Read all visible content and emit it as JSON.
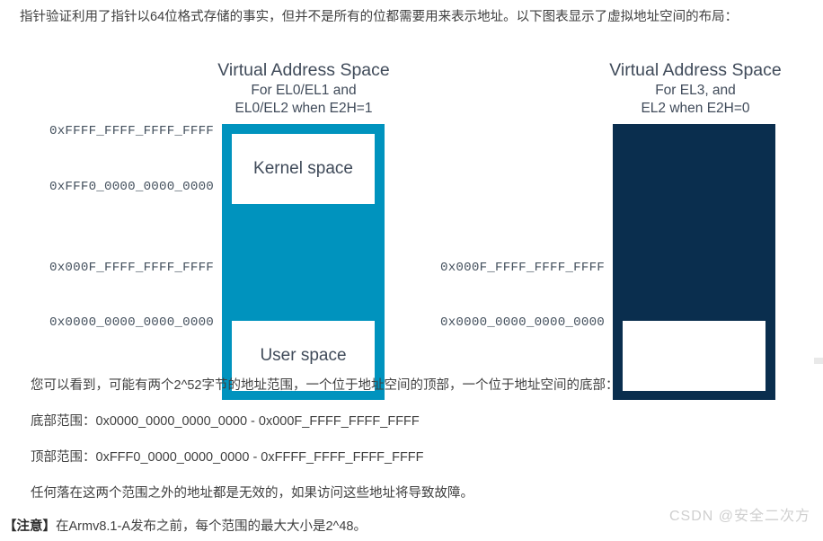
{
  "intro": {
    "text": "指针验证利用了指针以64位格式存储的事实，但并不是所有的位都需要用来表示地址。以下图表显示了虚拟地址空间的布局："
  },
  "figure": {
    "diagrams": [
      {
        "id": "left",
        "title_main": "Virtual Address Space",
        "title_sub_line1": "For EL0/EL1 and",
        "title_sub_line2": "EL0/EL2 when E2H=1",
        "fill_color": "#0093BE",
        "regions": [
          {
            "name": "kernel",
            "label": "Kernel space"
          },
          {
            "name": "user",
            "label": "User space"
          }
        ],
        "addresses": [
          {
            "id": "top-max",
            "value": "0xFFFF_FFFF_FFFF_FFFF"
          },
          {
            "id": "top-min",
            "value": "0xFFF0_0000_0000_0000"
          },
          {
            "id": "bot-max",
            "value": "0x000F_FFFF_FFFF_FFFF"
          },
          {
            "id": "bot-min",
            "value": "0x0000_0000_0000_0000"
          }
        ]
      },
      {
        "id": "right",
        "title_main": "Virtual Address Space",
        "title_sub_line1": "For EL3, and",
        "title_sub_line2": "EL2 when E2H=0",
        "fill_color": "#0A2E4E",
        "regions": [
          {
            "name": "low",
            "label": ""
          }
        ],
        "addresses": [
          {
            "id": "bot-max",
            "value": "0x000F_FFFF_FFFF_FFFF"
          },
          {
            "id": "bot-min",
            "value": "0x0000_0000_0000_0000"
          }
        ]
      }
    ]
  },
  "body": {
    "paragraph_1": "您可以看到，可能有两个2^52字节的地址范围，一个位于地址空间的顶部，一个位于地址空间的底部：",
    "paragraph_2": "底部范围：0x0000_0000_0000_0000 - 0x000F_FFFF_FFFF_FFFF",
    "paragraph_3": "顶部范围：0xFFF0_0000_0000_0000 - 0xFFFF_FFFF_FFFF_FFFF",
    "paragraph_4": "任何落在这两个范围之外的地址都是无效的，如果访问这些地址将导致故障。",
    "note_tag": "【注意】",
    "note_text": "在Armv8.1-A发布之前，每个范围的最大大小是2^48。"
  },
  "watermark": {
    "text": "CSDN @安全二次方"
  },
  "colors": {
    "teal": "#0093BE",
    "navy": "#0A2E4E",
    "heading": "#404B5A",
    "body_text": "#3f3f3f",
    "address_text": "#46525F",
    "watermark": "#cfcfcf"
  }
}
